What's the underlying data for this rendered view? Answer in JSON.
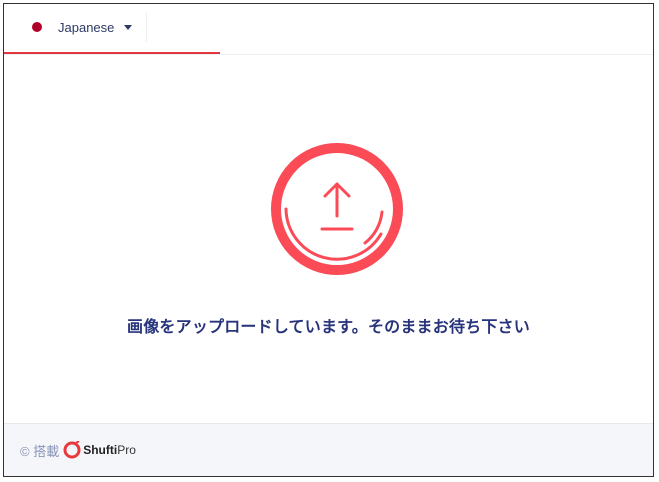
{
  "language_selector": {
    "label": "Japanese",
    "flag_color": "#b0002a"
  },
  "upload": {
    "icon": "upload-icon",
    "accent_color": "#fa4b57",
    "message": "画像をアップロードしています。そのままお待ち下さい"
  },
  "footer": {
    "powered_by": "© 搭載",
    "brand_part1": "Shufti",
    "brand_part2": "Pro"
  }
}
